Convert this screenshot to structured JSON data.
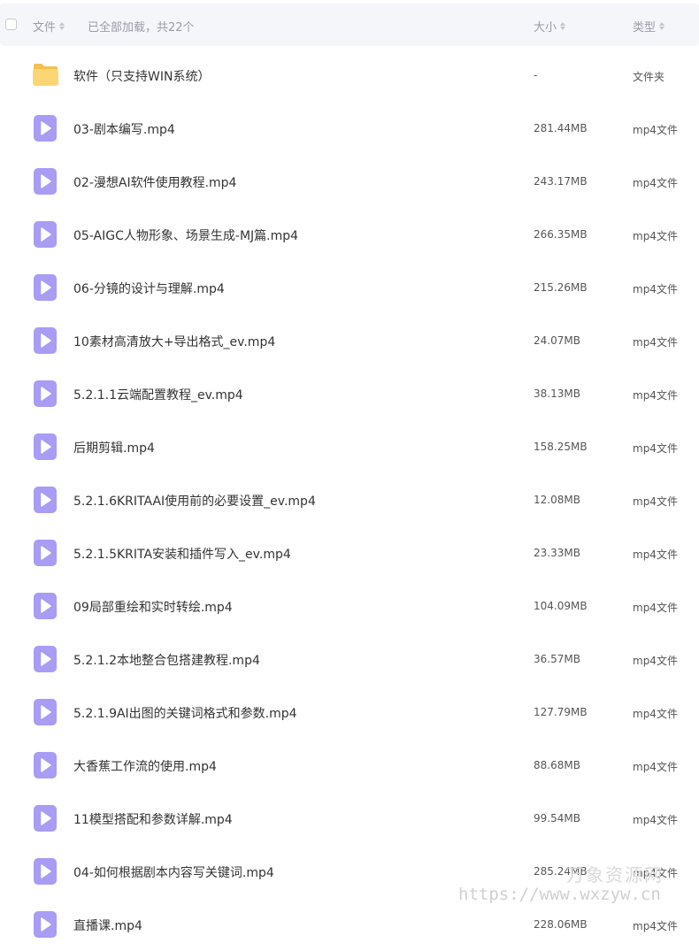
{
  "header": {
    "name_label": "文件",
    "status_text": "已全部加载，共22个",
    "size_label": "大小",
    "type_label": "类型"
  },
  "colors": {
    "video_icon": "#a89cf5",
    "folder_icon": "#fcd675",
    "header_bg": "#f5f6f9"
  },
  "files": [
    {
      "name": "软件（只支持WIN系统）",
      "size": "-",
      "type": "文件夹",
      "icon": "folder-icon"
    },
    {
      "name": "03-剧本编写.mp4",
      "size": "281.44MB",
      "type": "mp4文件",
      "icon": "video-file-icon"
    },
    {
      "name": "02-漫想AI软件使用教程.mp4",
      "size": "243.17MB",
      "type": "mp4文件",
      "icon": "video-file-icon"
    },
    {
      "name": "05-AIGC人物形象、场景生成-MJ篇.mp4",
      "size": "266.35MB",
      "type": "mp4文件",
      "icon": "video-file-icon"
    },
    {
      "name": "06-分镜的设计与理解.mp4",
      "size": "215.26MB",
      "type": "mp4文件",
      "icon": "video-file-icon"
    },
    {
      "name": "10素材高清放大+导出格式_ev.mp4",
      "size": "24.07MB",
      "type": "mp4文件",
      "icon": "video-file-icon"
    },
    {
      "name": "5.2.1.1云端配置教程_ev.mp4",
      "size": "38.13MB",
      "type": "mp4文件",
      "icon": "video-file-icon"
    },
    {
      "name": "后期剪辑.mp4",
      "size": "158.25MB",
      "type": "mp4文件",
      "icon": "video-file-icon"
    },
    {
      "name": "5.2.1.6KRITAAI使用前的必要设置_ev.mp4",
      "size": "12.08MB",
      "type": "mp4文件",
      "icon": "video-file-icon"
    },
    {
      "name": "5.2.1.5KRITA安装和插件写入_ev.mp4",
      "size": "23.33MB",
      "type": "mp4文件",
      "icon": "video-file-icon"
    },
    {
      "name": "09局部重绘和实时转绘.mp4",
      "size": "104.09MB",
      "type": "mp4文件",
      "icon": "video-file-icon"
    },
    {
      "name": "5.2.1.2本地整合包搭建教程.mp4",
      "size": "36.57MB",
      "type": "mp4文件",
      "icon": "video-file-icon"
    },
    {
      "name": "5.2.1.9AI出图的关键词格式和参数.mp4",
      "size": "127.79MB",
      "type": "mp4文件",
      "icon": "video-file-icon"
    },
    {
      "name": "大香蕉工作流的使用.mp4",
      "size": "88.68MB",
      "type": "mp4文件",
      "icon": "video-file-icon"
    },
    {
      "name": "11模型搭配和参数详解.mp4",
      "size": "99.54MB",
      "type": "mp4文件",
      "icon": "video-file-icon"
    },
    {
      "name": "04-如何根据剧本内容写关键词.mp4",
      "size": "285.24MB",
      "type": "mp4文件",
      "icon": "video-file-icon"
    },
    {
      "name": "直播课.mp4",
      "size": "228.06MB",
      "type": "mp4文件",
      "icon": "video-file-icon"
    }
  ],
  "watermark": {
    "line1": "万象资源网",
    "line2": "https://www.wxzyw.cn"
  }
}
